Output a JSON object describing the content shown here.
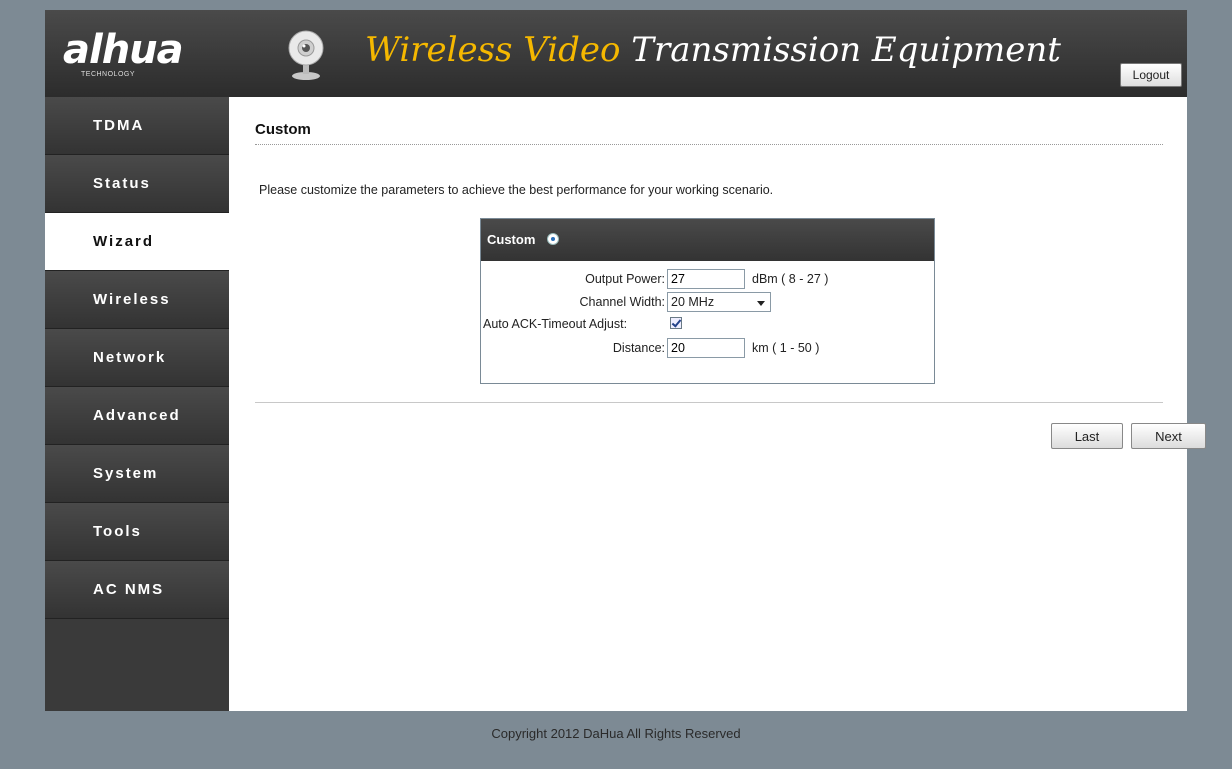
{
  "header": {
    "logo_text": "alhua",
    "logo_sub": "TECHNOLOGY",
    "title_part1": "Wireless Video",
    "title_part2": "Transmission Equipment",
    "logout_label": "Logout",
    "title_accent_color": "#f5b800"
  },
  "sidebar": {
    "items": [
      {
        "label": "TDMA",
        "active": false
      },
      {
        "label": "Status",
        "active": false
      },
      {
        "label": "Wizard",
        "active": true
      },
      {
        "label": "Wireless",
        "active": false
      },
      {
        "label": "Network",
        "active": false
      },
      {
        "label": "Advanced",
        "active": false
      },
      {
        "label": "System",
        "active": false
      },
      {
        "label": "Tools",
        "active": false
      },
      {
        "label": "AC NMS",
        "active": false
      }
    ]
  },
  "main": {
    "section_title": "Custom",
    "intro": "Please customize the parameters to achieve the best performance for your working scenario.",
    "panel": {
      "title": "Custom",
      "radio_selected": true,
      "output_power_label": "Output Power:",
      "output_power_value": "27",
      "output_power_unit": "dBm ( 8 - 27 )",
      "channel_width_label": "Channel Width:",
      "channel_width_value": "20 MHz",
      "ack_label": "Auto ACK-Timeout Adjust:",
      "ack_checked": true,
      "distance_label": "Distance:",
      "distance_value": "20",
      "distance_unit": "km ( 1 - 50 )"
    },
    "last_label": "Last",
    "next_label": "Next"
  },
  "footer": {
    "copyright": "Copyright 2012 DaHua All Rights Reserved"
  }
}
